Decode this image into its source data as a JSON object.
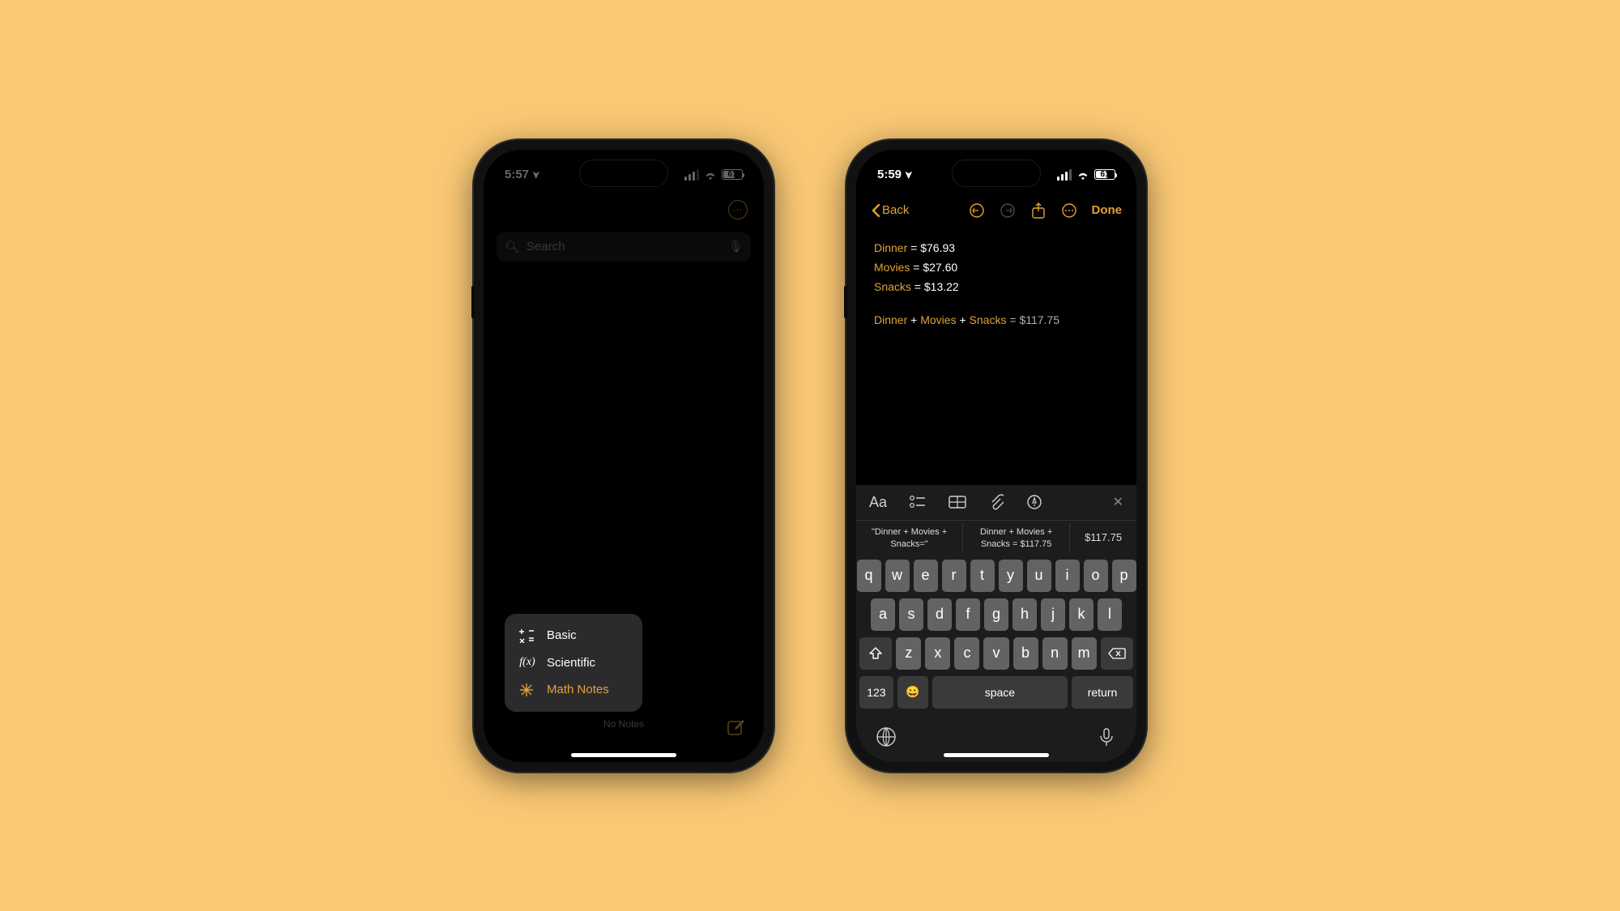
{
  "statusbar_left": {
    "time": "5:57",
    "battery": "61"
  },
  "statusbar_right": {
    "time": "5:59",
    "battery": "61"
  },
  "notes_list": {
    "search_placeholder": "Search",
    "footer": "No Notes"
  },
  "popup": {
    "items": [
      {
        "label": "Basic"
      },
      {
        "label": "Scientific"
      },
      {
        "label": "Math Notes"
      }
    ]
  },
  "editor": {
    "back_label": "Back",
    "done_label": "Done",
    "lines": [
      {
        "var": "Dinner",
        "val": "$76.93"
      },
      {
        "var": "Movies",
        "val": "$27.60"
      },
      {
        "var": "Snacks",
        "val": "$13.22"
      }
    ],
    "sum_expr": {
      "a": "Dinner",
      "b": "Movies",
      "c": "Snacks",
      "result": "$117.75"
    }
  },
  "fmt_glyphs": {
    "aa": "Aa"
  },
  "suggestions": [
    "\"Dinner + Movies + Snacks=\"",
    "Dinner + Movies + Snacks = $117.75",
    "$117.75"
  ],
  "keyboard": {
    "row1": [
      "q",
      "w",
      "e",
      "r",
      "t",
      "y",
      "u",
      "i",
      "o",
      "p"
    ],
    "row2": [
      "a",
      "s",
      "d",
      "f",
      "g",
      "h",
      "j",
      "k",
      "l"
    ],
    "row3": [
      "z",
      "x",
      "c",
      "v",
      "b",
      "n",
      "m"
    ],
    "num": "123",
    "space": "space",
    "return": "return"
  }
}
